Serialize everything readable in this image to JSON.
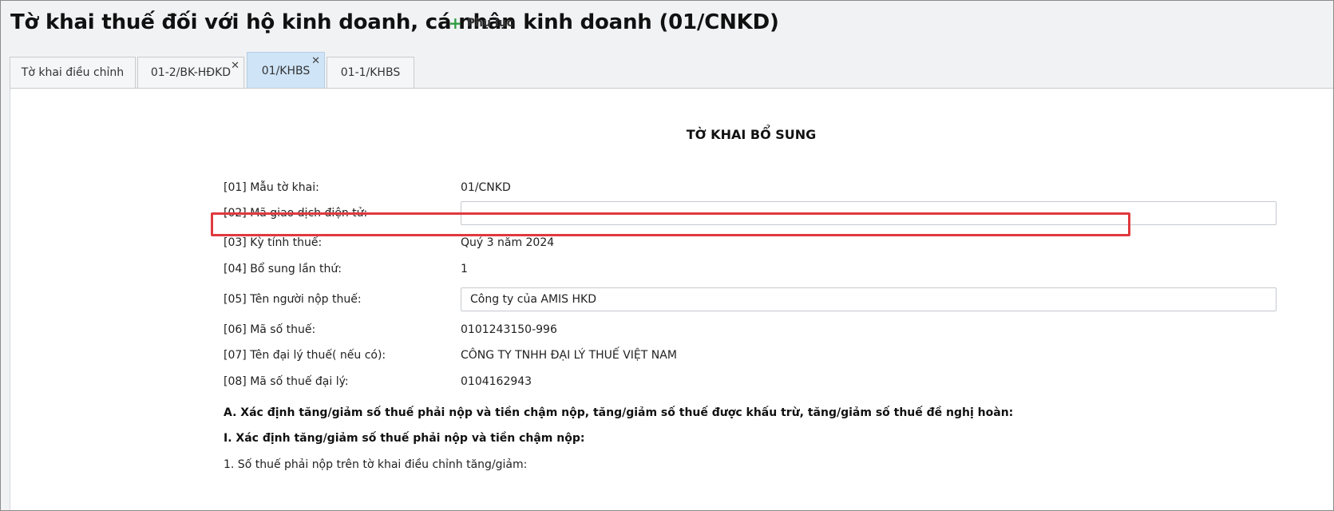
{
  "page": {
    "title": "Tờ khai thuế đối với hộ kinh doanh, cá nhân kinh doanh (01/CNKD)"
  },
  "tabs": [
    {
      "label": "Tờ khai điều chỉnh",
      "closable": false,
      "active": false
    },
    {
      "label": "01-2/BK-HĐKD",
      "closable": true,
      "active": false
    },
    {
      "label": "01/KHBS",
      "closable": true,
      "active": true
    },
    {
      "label": "01-1/KHBS",
      "closable": false,
      "active": false
    }
  ],
  "tab_addon": {
    "label": "Phụ lục",
    "icon": "plus-icon"
  },
  "close_glyph": "✕",
  "form": {
    "title": "TỜ KHAI BỔ SUNG",
    "rows": [
      {
        "label": "[01] Mẫu tờ khai:",
        "value": "01/CNKD"
      },
      {
        "label": "[02] Mã giao dịch điện tử:",
        "value": ""
      },
      {
        "label": "[03] Kỳ tính thuế:",
        "value": "Quý 3 năm 2024"
      },
      {
        "label": "[04] Bổ sung lần thứ:",
        "value": "1"
      },
      {
        "label": "[05] Tên người nộp thuế:",
        "value": "Công ty của AMIS HKD"
      },
      {
        "label": "[06] Mã số thuế:",
        "value": "0101243150-996"
      },
      {
        "label": "[07] Tên đại lý thuế( nếu có):",
        "value": "CÔNG TY TNHH ĐẠI LÝ THUẾ VIỆT NAM"
      },
      {
        "label": "[08] Mã số thuế đại lý:",
        "value": "0104162943"
      }
    ],
    "section_a": "A. Xác định tăng/giảm số thuế phải nộp và tiền chậm nộp, tăng/giảm số thuế được khấu trừ, tăng/giảm số thuế đề nghị hoàn:",
    "section_i": "I. Xác định tăng/giảm số thuế phải nộp và tiền chậm nộp:",
    "item_1": "1. Số thuế phải nộp trên tờ khai điều chỉnh tăng/giảm:"
  },
  "colors": {
    "highlight": "#e0393e",
    "active_tab": "#cfe4f7",
    "accent_plus": "#2e9e3f"
  }
}
